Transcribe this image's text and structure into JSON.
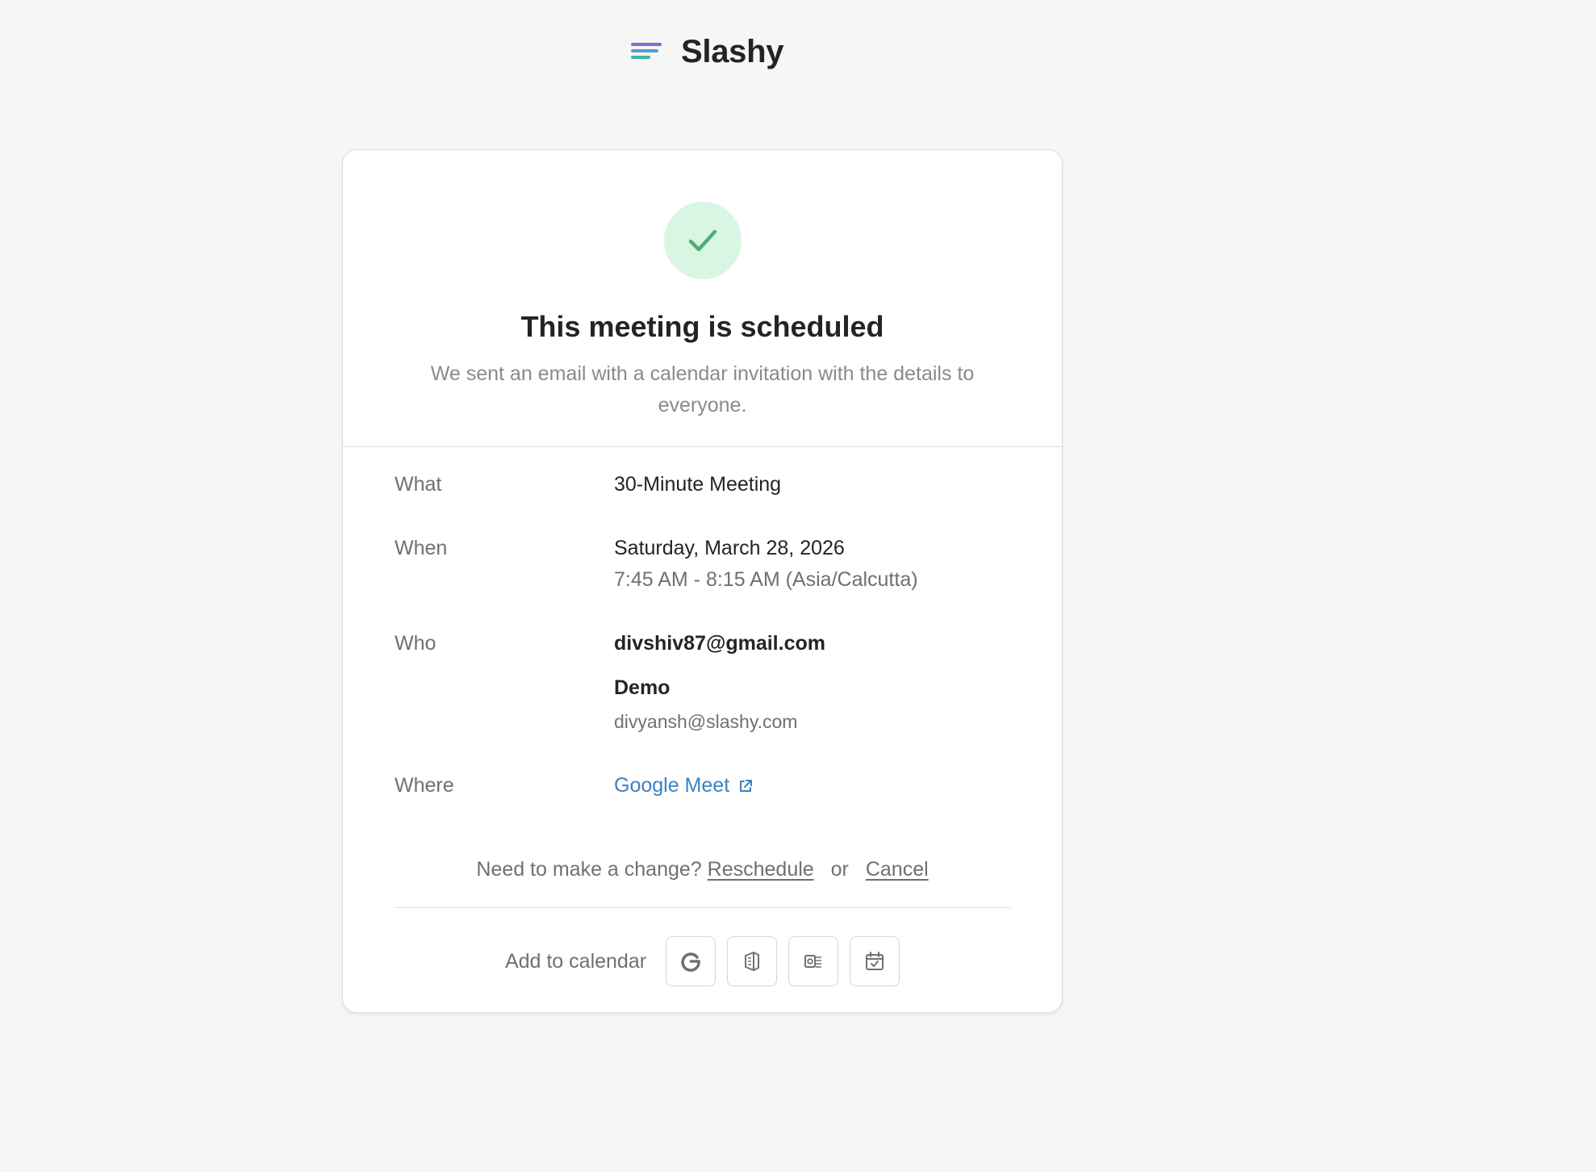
{
  "brand": {
    "name": "Slashy",
    "logo_icon": "stacked-lines-logo"
  },
  "status": {
    "icon": "check-icon",
    "title": "This meeting is scheduled",
    "subtitle": "We sent an email with a calendar invitation with the details to everyone."
  },
  "details": {
    "what": {
      "label": "What",
      "value": "30-Minute Meeting"
    },
    "when": {
      "label": "When",
      "date": "Saturday, March 28, 2026",
      "time": "7:45 AM - 8:15 AM (Asia/Calcutta)"
    },
    "who": {
      "label": "Who",
      "attendee_email": "divshiv87@gmail.com",
      "host_name": "Demo",
      "host_email": "divyansh@slashy.com"
    },
    "where": {
      "label": "Where",
      "link_text": "Google Meet",
      "link_icon": "external-link-icon"
    }
  },
  "change": {
    "prompt": "Need to make a change?",
    "reschedule": "Reschedule",
    "or": "or",
    "cancel": "Cancel"
  },
  "calendar": {
    "label": "Add to calendar",
    "buttons": [
      "google-calendar-icon",
      "office365-icon",
      "outlook-icon",
      "ics-calendar-icon"
    ]
  },
  "colors": {
    "background": "#f6f6f5",
    "success_circle": "#d8f6e3",
    "success_check": "#4caf73",
    "link": "#3b82c4"
  }
}
